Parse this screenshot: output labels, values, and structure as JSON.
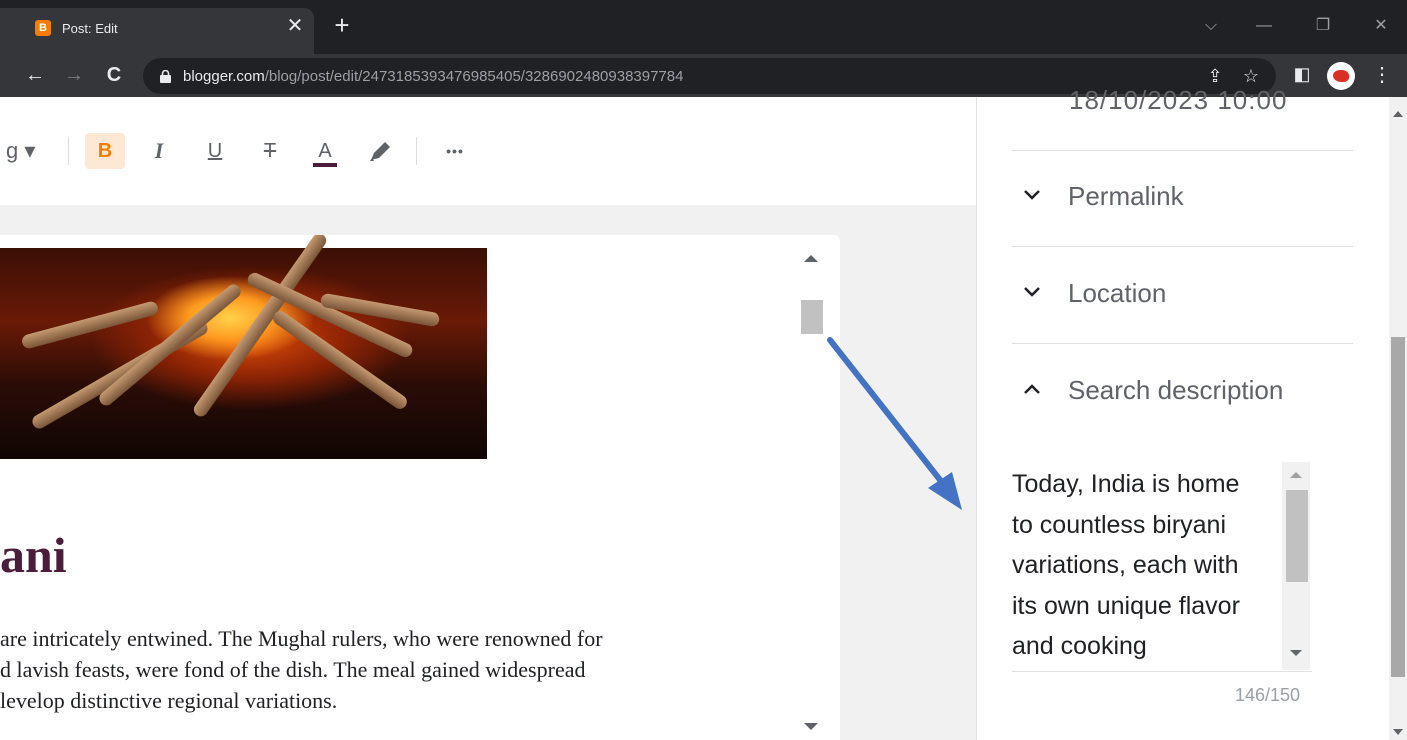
{
  "browser": {
    "tab_title": "Post: Edit",
    "tab_favicon_letter": "B",
    "tab_close": "✕",
    "new_tab": "+",
    "window_controls": {
      "minimize": "—",
      "restore": "❐",
      "close": "✕",
      "tab_search": "⌵"
    },
    "url_host": "blogger.com",
    "url_path": "/blog/post/edit/2473185393476985405/3286902480938397784",
    "nav": {
      "back": "←",
      "forward": "→",
      "reload": "C"
    },
    "icons": {
      "share": "⇪",
      "bookmark": "☆",
      "side_panel": "◧",
      "menu": "⋮"
    }
  },
  "editor_toolbar": {
    "font_dropdown": "g ▾",
    "bold": "B",
    "italic": "I",
    "underline": "U",
    "strikethrough": "T",
    "text_color": "A",
    "text_color_value": "#4a1e3a",
    "highlight_icon": "marker-icon",
    "more": "•••"
  },
  "post": {
    "heading": "ani",
    "body_lines": [
      "are intricately entwined. The Mughal rulers, who were renowned for",
      "d lavish feasts, were fond of the dish. The meal gained widespread",
      "levelop distinctive regional variations."
    ]
  },
  "side_panel": {
    "publish_date": "18/10/2023 10:00",
    "sections": [
      {
        "label": "Permalink",
        "expanded": false
      },
      {
        "label": "Location",
        "expanded": false
      },
      {
        "label": "Search description",
        "expanded": true
      }
    ],
    "search_description_lines": [
      "Today, India is home",
      "to countless biryani",
      "variations, each with",
      "its own unique flavor",
      "and cooking"
    ],
    "char_count": "146/150"
  },
  "colors": {
    "accent": "#f57d00",
    "heading": "#4a1e3a",
    "annotation_arrow": "#4472c4"
  }
}
